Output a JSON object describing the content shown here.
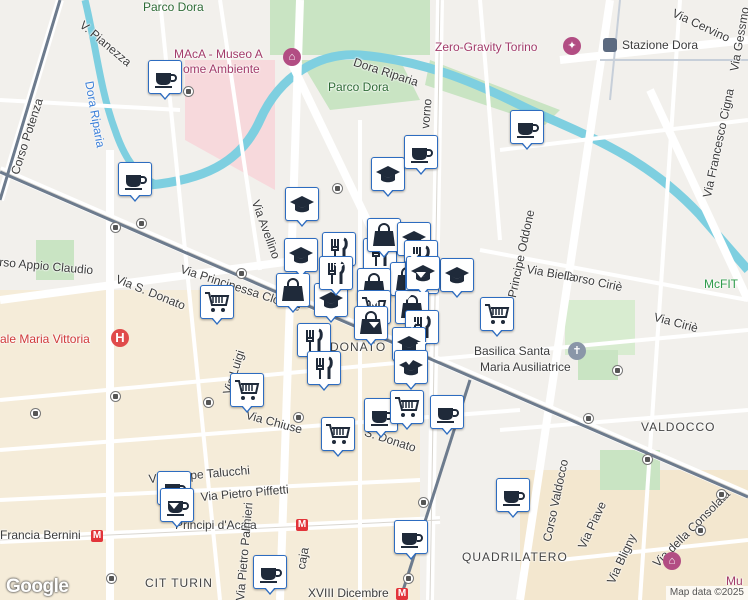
{
  "map": {
    "labels": {
      "parco_dora_top": "Parco Dora",
      "museo": "MAcA - Museo A",
      "museo2": "ome Ambiente",
      "dora_riparia_top": "Dora Riparia",
      "parco_dora": "Parco Dora",
      "zero_gravity": "Zero-Gravity Torino",
      "stazione_dora": "Stazione Dora",
      "via_cervino": "Via Cervino",
      "v_pianezza": "V. Pianezza",
      "dora_riparia_left": "Dora Riparia",
      "corso_potenza": "Corso Potenza",
      "via_avellino": "Via Avellino",
      "rso_appio_claudio": "rso Appio Claudio",
      "via_s_donato": "Via S. Donato",
      "via_principessa": "Via Principessa Clotilde",
      "mcfit": "McFIT",
      "corso_cirie": "Corso Ciriè",
      "via_biella": "Via Biella",
      "principe_oddone": "Principe Oddone",
      "via_cirie": "Via Ciriè",
      "via_francesco": "Via Francesco Cigna",
      "via_gessmo": "Via Gessmo",
      "vorno": "vorno",
      "ale_maria_vittoria": "ale Maria Vittoria",
      "donato": "DONATO",
      "basilica1": "Basilica Santa",
      "basilica2": "Maria Ausiliatrice",
      "via_luigi": "Via Luigi",
      "via_chiuse": "Via Chiuse",
      "s_donato_lower": "S. Donato",
      "valdocco": "VALDOCCO",
      "via_peppe_talucchi": "Via Peppe Talucchi",
      "via_pietro_piffetti": "Via Pietro Piffetti",
      "principi_dacaja": "Principi d'Acaja",
      "francia_bernini": "Francia Bernini",
      "corso_valdocco": "Corso Valdocco",
      "via_piave": "Via Piave",
      "via_della_consolata": "Via della Consolata",
      "via_bligny": "Via Bligny",
      "quadrilatero": "QUADRILATERO",
      "cit_turin": "CIT TURIN",
      "via_pietro_palmieri": "Via Pietro Palmieri",
      "caja": "caja",
      "xviii_dicembre": "XVIII Dicembre",
      "mu": "Mu"
    },
    "google_logo": "Google",
    "attribution": "Map data ©2025",
    "markers": [
      {
        "type": "cafe"
      },
      {
        "type": "cafe"
      },
      {
        "type": "school"
      },
      {
        "type": "cafe"
      },
      {
        "type": "cafe"
      },
      {
        "type": "school"
      },
      {
        "type": "school"
      },
      {
        "type": "restaurant"
      },
      {
        "type": "restaurant"
      },
      {
        "type": "shop"
      },
      {
        "type": "school"
      },
      {
        "type": "restaurant"
      },
      {
        "type": "shop"
      },
      {
        "type": "school"
      },
      {
        "type": "school"
      },
      {
        "type": "grocery"
      },
      {
        "type": "shop"
      },
      {
        "type": "school"
      },
      {
        "type": "restaurant"
      },
      {
        "type": "shop"
      },
      {
        "type": "grocery"
      },
      {
        "type": "grocery"
      },
      {
        "type": "shop"
      },
      {
        "type": "school"
      },
      {
        "type": "restaurant"
      },
      {
        "type": "shop"
      },
      {
        "type": "restaurant"
      },
      {
        "type": "school"
      },
      {
        "type": "school"
      },
      {
        "type": "restaurant"
      },
      {
        "type": "grocery"
      },
      {
        "type": "cafe"
      },
      {
        "type": "grocery"
      },
      {
        "type": "cafe"
      },
      {
        "type": "grocery"
      },
      {
        "type": "cafe"
      },
      {
        "type": "cafe"
      },
      {
        "type": "cafe"
      },
      {
        "type": "cafe"
      },
      {
        "type": "cafe"
      }
    ],
    "colors": {
      "marker_border": "#2d6cc0",
      "icon": "#1f2a3a",
      "river": "#7ecfe0",
      "park": "#c9e4c3"
    }
  }
}
